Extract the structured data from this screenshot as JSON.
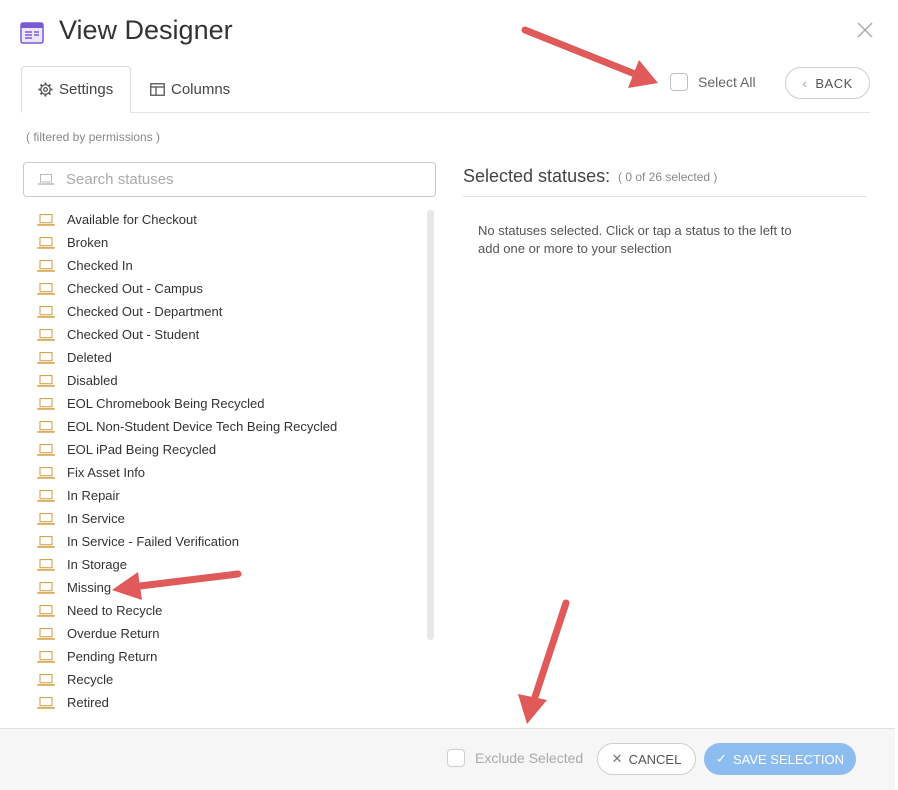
{
  "header": {
    "title": "View Designer"
  },
  "tabs": [
    {
      "label": "Settings",
      "icon": "gear-icon",
      "active": true
    },
    {
      "label": "Columns",
      "icon": "columns-icon",
      "active": false
    }
  ],
  "select_all": {
    "label": "Select All",
    "checked": false
  },
  "back_button": {
    "label": "BACK"
  },
  "filter_note": "( filtered by permissions )",
  "search": {
    "placeholder": "Search statuses",
    "value": ""
  },
  "statuses": [
    "Available for Checkout",
    "Broken",
    "Checked In",
    "Checked Out - Campus",
    "Checked Out - Department",
    "Checked Out - Student",
    "Deleted",
    "Disabled",
    "EOL Chromebook Being Recycled",
    "EOL Non-Student Device Tech Being Recycled",
    "EOL iPad Being Recycled",
    "Fix Asset Info",
    "In Repair",
    "In Service",
    "In Service - Failed Verification",
    "In Storage",
    "Missing",
    "Need to Recycle",
    "Overdue Return",
    "Pending Return",
    "Recycle",
    "Retired"
  ],
  "selected_panel": {
    "heading": "Selected statuses:",
    "count": "( 0 of 26 selected )",
    "empty_message": "No statuses selected. Click or tap a status to the left to add one or more to your selection"
  },
  "footer": {
    "exclude_label": "Exclude Selected",
    "cancel_label": "CANCEL",
    "save_label": "SAVE SELECTION"
  },
  "colors": {
    "accent": "#8cbcf0",
    "status_icon": "#d9a24a",
    "arrow": "#e05a5a"
  }
}
